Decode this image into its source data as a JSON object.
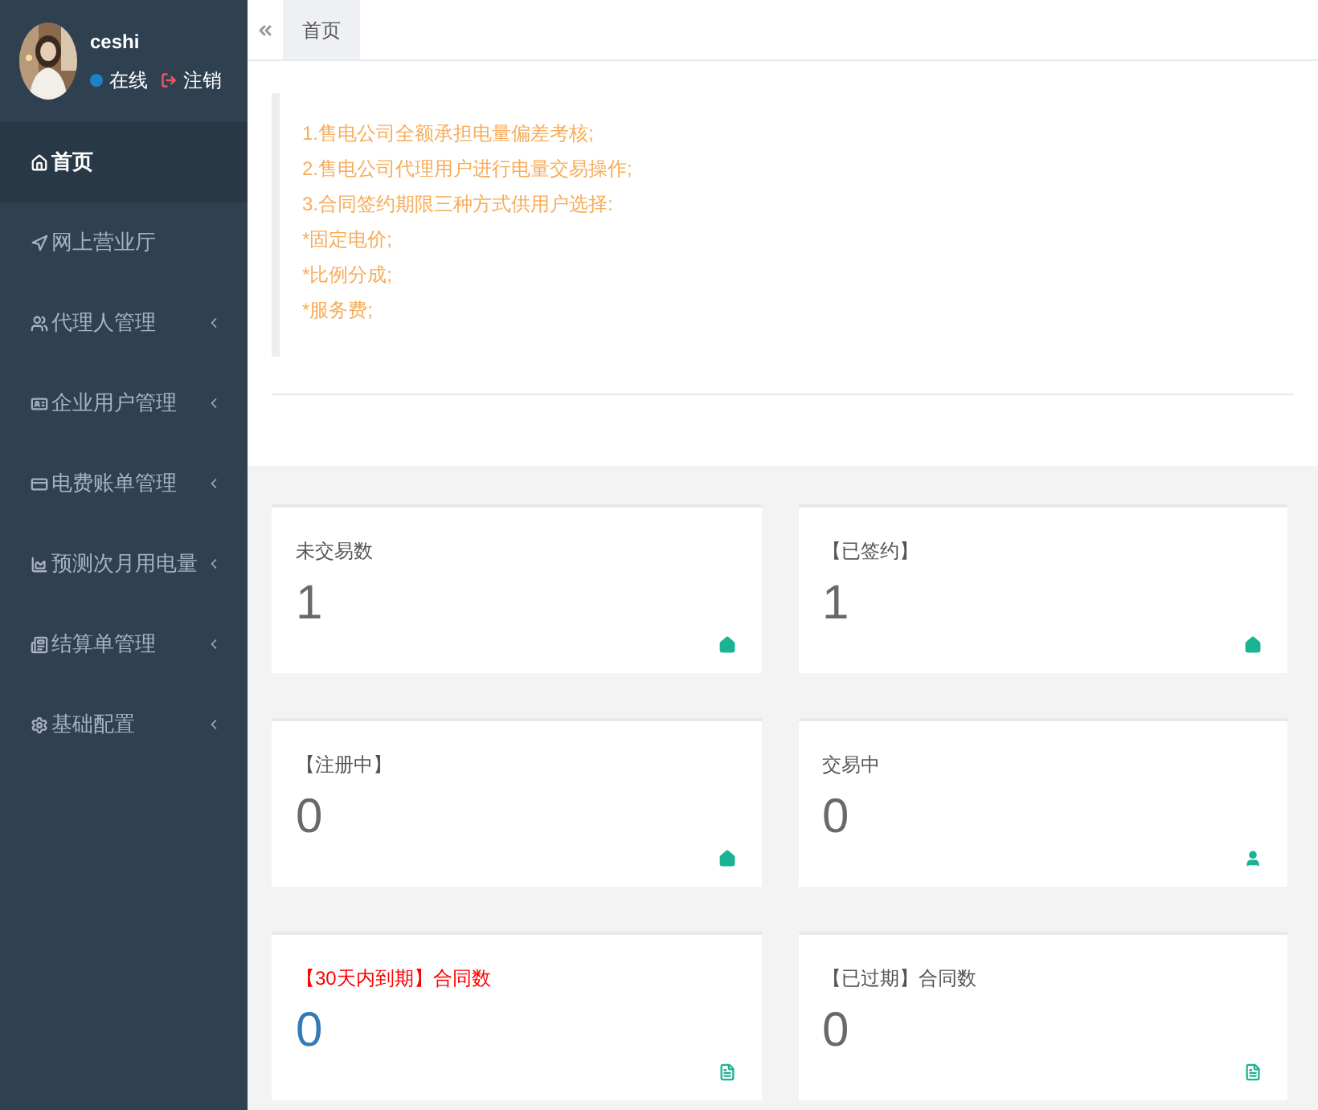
{
  "user": {
    "name": "ceshi",
    "status": "在线",
    "logout": "注销"
  },
  "sidebar": {
    "items": [
      {
        "label": "首页",
        "kind": "home",
        "selected": true,
        "has_children": false
      },
      {
        "label": "网上营业厅",
        "kind": "arrow",
        "selected": false,
        "has_children": false
      },
      {
        "label": "代理人管理",
        "kind": "users",
        "selected": false,
        "has_children": true
      },
      {
        "label": "企业用户管理",
        "kind": "card",
        "selected": false,
        "has_children": true
      },
      {
        "label": "电费账单管理",
        "kind": "bill",
        "selected": false,
        "has_children": true
      },
      {
        "label": "预测次月用电量",
        "kind": "chart",
        "selected": false,
        "has_children": true
      },
      {
        "label": "结算单管理",
        "kind": "list",
        "selected": false,
        "has_children": true
      },
      {
        "label": "基础配置",
        "kind": "gear",
        "selected": false,
        "has_children": true
      }
    ]
  },
  "tabs": [
    {
      "label": "首页",
      "selected": true
    }
  ],
  "notice": {
    "lines": [
      "1.售电公司全额承担电量偏差考核;",
      "2.售电公司代理用户进行电量交易操作;",
      "3.合同签约期限三种方式供用户选择:",
      "*固定电价;",
      "*比例分成;",
      "*服务费;"
    ]
  },
  "cards": [
    {
      "title": "未交易数",
      "value": "1",
      "kind": "home",
      "alert": false
    },
    {
      "title": "【已签约】",
      "value": "1",
      "kind": "home",
      "alert": false
    },
    {
      "title": "【注册中】",
      "value": "0",
      "kind": "home",
      "alert": false
    },
    {
      "title": "交易中",
      "value": "0",
      "kind": "user",
      "alert": false
    },
    {
      "title": "【30天内到期】合同数",
      "value": "0",
      "kind": "file",
      "alert": true
    },
    {
      "title": "【已过期】合同数",
      "value": "0",
      "kind": "file",
      "alert": false
    }
  ]
}
